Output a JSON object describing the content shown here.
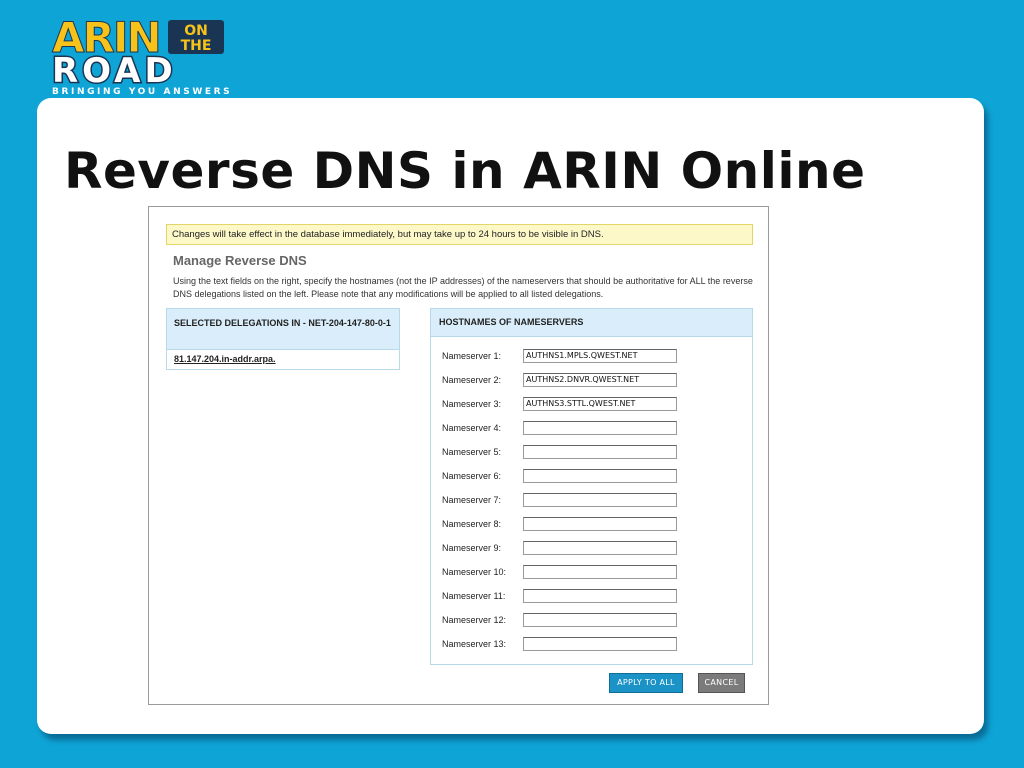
{
  "logo": {
    "line1": "ARIN",
    "badge_line1": "ON",
    "badge_line2": "THE",
    "line2": "ROAD",
    "tagline": "BRINGING YOU ANSWERS"
  },
  "slide": {
    "title": "Reverse DNS in ARIN Online"
  },
  "screenshot": {
    "notice": "Changes will take effect in the database immediately, but may take up to 24 hours to be visible in DNS.",
    "section_title": "Manage Reverse DNS",
    "intro": "Using the text fields on the right, specify the hostnames (not the IP addresses) of the nameservers that should be authoritative for ALL the reverse DNS delegations listed on the left. Please note that any modifications will be applied to all listed delegations.",
    "delegations": {
      "header": "SELECTED DELEGATIONS IN - NET-204-147-80-0-1",
      "items": [
        "81.147.204.in-addr.arpa."
      ]
    },
    "nameservers": {
      "header": "HOSTNAMES OF NAMESERVERS",
      "rows": [
        {
          "label": "Nameserver 1:",
          "value": "AUTHNS1.MPLS.QWEST.NET"
        },
        {
          "label": "Nameserver 2:",
          "value": "AUTHNS2.DNVR.QWEST.NET"
        },
        {
          "label": "Nameserver 3:",
          "value": "AUTHNS3.STTL.QWEST.NET"
        },
        {
          "label": "Nameserver 4:",
          "value": ""
        },
        {
          "label": "Nameserver 5:",
          "value": ""
        },
        {
          "label": "Nameserver 6:",
          "value": ""
        },
        {
          "label": "Nameserver 7:",
          "value": ""
        },
        {
          "label": "Nameserver 8:",
          "value": ""
        },
        {
          "label": "Nameserver 9:",
          "value": ""
        },
        {
          "label": "Nameserver 10:",
          "value": ""
        },
        {
          "label": "Nameserver 11:",
          "value": ""
        },
        {
          "label": "Nameserver 12:",
          "value": ""
        },
        {
          "label": "Nameserver 13:",
          "value": ""
        }
      ]
    },
    "buttons": {
      "apply": "APPLY TO ALL",
      "cancel": "CANCEL"
    }
  },
  "colors": {
    "background": "#0fa4d6",
    "logo_yellow": "#f7c21a",
    "logo_navy": "#1a3553",
    "panel_header": "#d9eefa",
    "notice_bg": "#fdf8c8",
    "apply_button": "#1b93c6",
    "cancel_button": "#7b7b7b"
  }
}
